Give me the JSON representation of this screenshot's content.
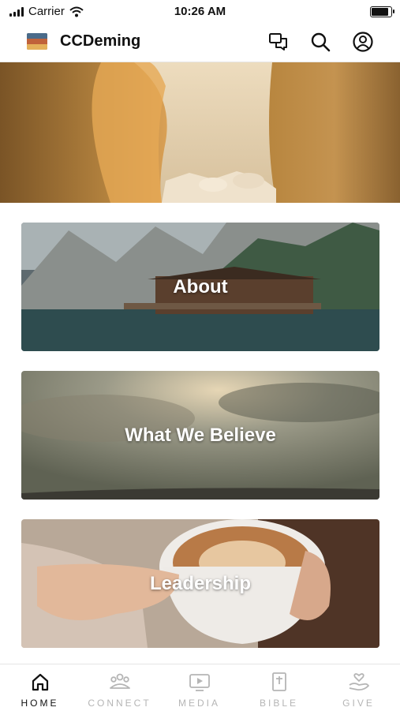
{
  "status_bar": {
    "carrier": "Carrier",
    "time": "10:26 AM"
  },
  "header": {
    "title": "CCDeming"
  },
  "cards": [
    {
      "label": "About"
    },
    {
      "label": "What We Believe"
    },
    {
      "label": "Leadership"
    }
  ],
  "tabs": [
    {
      "label": "HOME",
      "icon": "home-icon",
      "active": true
    },
    {
      "label": "CONNECT",
      "icon": "people-icon",
      "active": false
    },
    {
      "label": "MEDIA",
      "icon": "play-icon",
      "active": false
    },
    {
      "label": "BIBLE",
      "icon": "bible-icon",
      "active": false
    },
    {
      "label": "GIVE",
      "icon": "give-icon",
      "active": false
    }
  ],
  "colors": {
    "accent": "#111111",
    "inactive": "#b5b5b5"
  }
}
